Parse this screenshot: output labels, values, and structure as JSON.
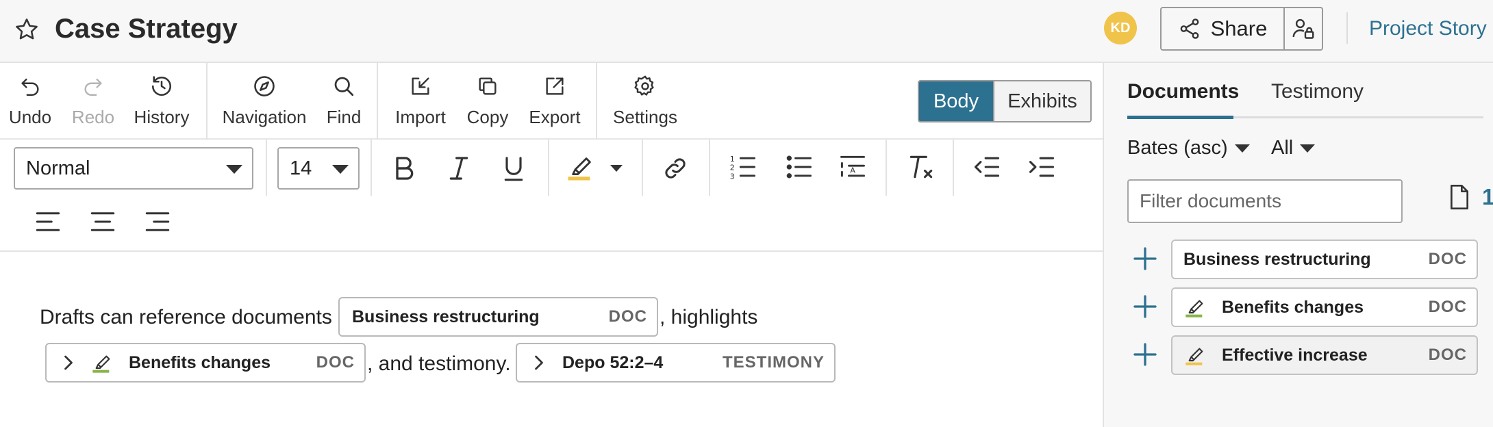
{
  "header": {
    "title": "Case Strategy",
    "avatar_initials": "KD",
    "avatar_color": "#f0c34a",
    "share_label": "Share",
    "project_story_label": "Project Story"
  },
  "toolbar": {
    "undo": "Undo",
    "redo": "Redo",
    "history": "History",
    "navigation": "Navigation",
    "find": "Find",
    "import": "Import",
    "copy": "Copy",
    "export": "Export",
    "settings": "Settings",
    "view_tabs": {
      "body": "Body",
      "exhibits": "Exhibits",
      "active": "Body"
    }
  },
  "format": {
    "style_select": "Normal",
    "size_select": "14",
    "highlight_color": "#f0c34a"
  },
  "editor": {
    "text_1": "Drafts can reference documents",
    "chip_1": {
      "label": "Business restructuring",
      "type": "DOC"
    },
    "text_2": ", highlights",
    "chip_2": {
      "label": "Benefits changes",
      "type": "DOC",
      "highlight_color": "#8ab34a"
    },
    "text_3": ", and testimony.",
    "chip_3": {
      "label": "Depo 52:2–4",
      "type": "TESTIMONY"
    }
  },
  "panel": {
    "tabs": [
      "Documents",
      "Testimony"
    ],
    "active_tab": "Documents",
    "sort_dropdown": "Bates (asc)",
    "filter_dropdown": "All",
    "filter_placeholder": "Filter documents",
    "doc_count": "1",
    "items": [
      {
        "label": "Business restructuring",
        "type": "DOC",
        "highlight": false
      },
      {
        "label": "Benefits changes",
        "type": "DOC",
        "highlight": true,
        "highlight_color": "#8ab34a"
      },
      {
        "label": "Effective increase",
        "type": "DOC",
        "highlight": true,
        "highlight_color": "#f0c34a"
      }
    ]
  },
  "colors": {
    "accent": "#2c7190",
    "header_bg": "#f7f7f7"
  }
}
